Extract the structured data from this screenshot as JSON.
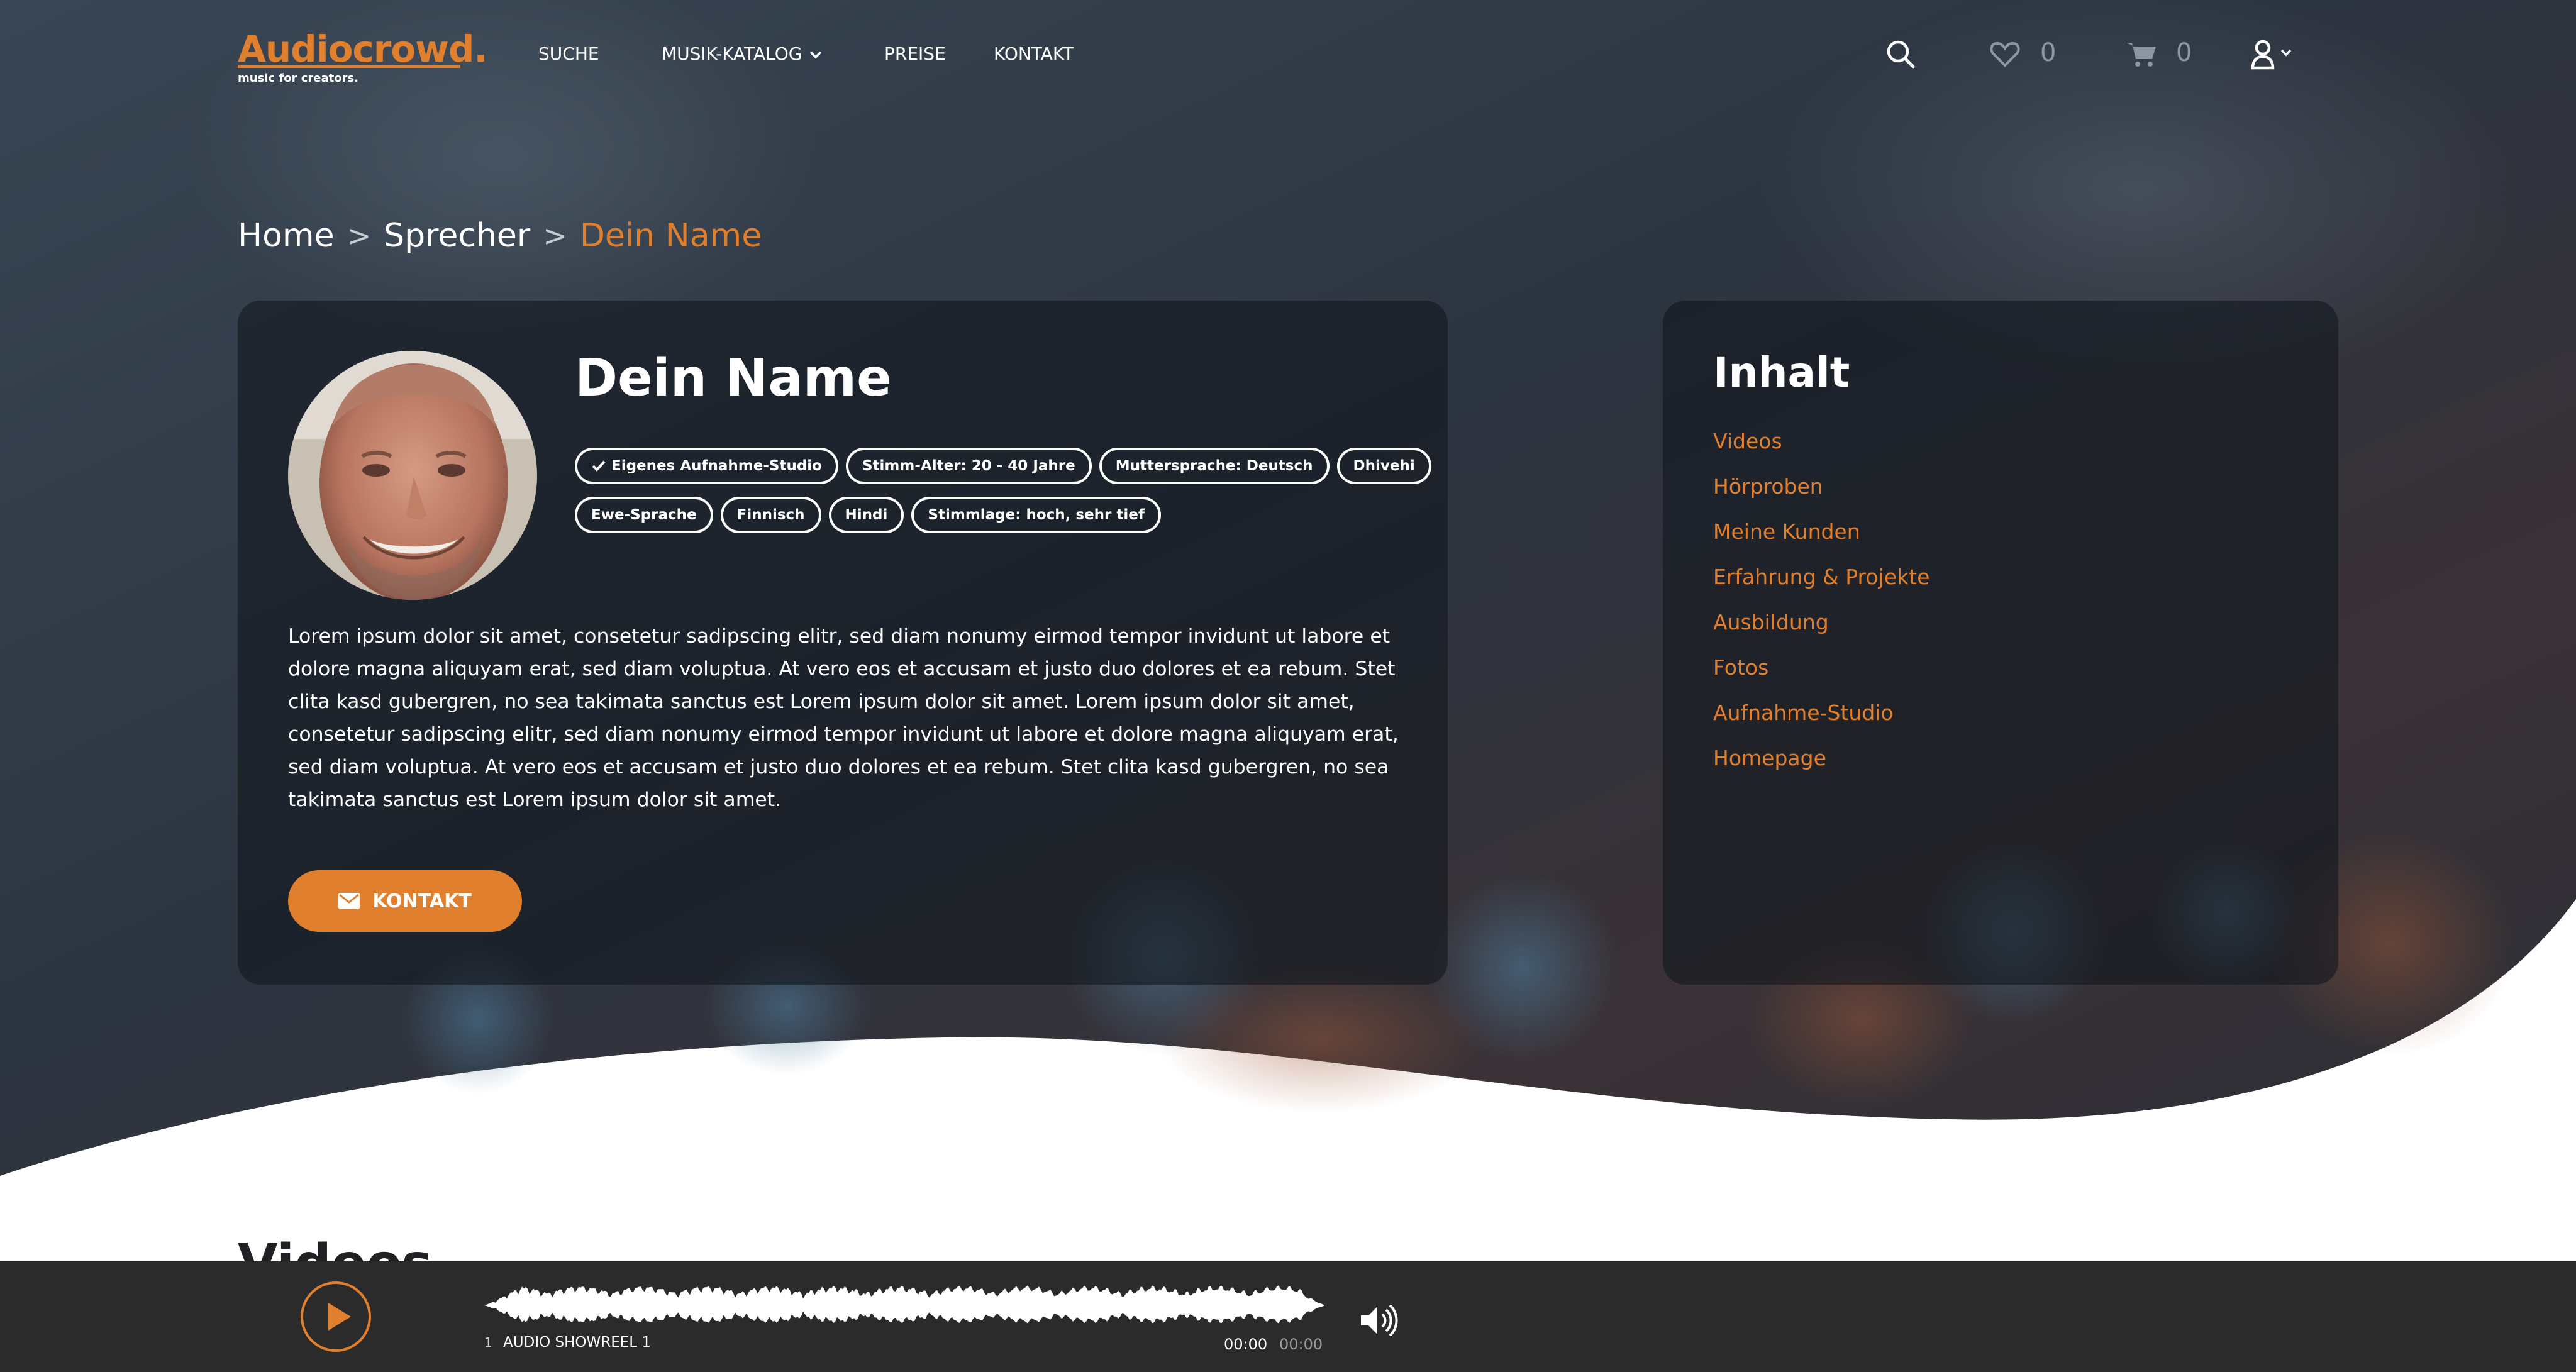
{
  "brand": {
    "name": "Audiocrowd.",
    "tagline": "music for creators."
  },
  "nav": {
    "links": [
      "SUCHE",
      "MUSIK-KATALOG",
      "PREISE",
      "KONTAKT"
    ],
    "wishlist_count": "0",
    "cart_count": "0"
  },
  "breadcrumb": {
    "items": [
      "Home",
      "Sprecher",
      "Dein Name"
    ],
    "separator": ">"
  },
  "profile": {
    "name": "Dein Name",
    "tags_row1": [
      "Eigenes Aufnahme-Studio",
      "Stimm-Alter: 20 - 40 Jahre",
      "Muttersprache: Deutsch",
      "Dhivehi"
    ],
    "tags_row2": [
      "Ewe-Sprache",
      "Finnisch",
      "Hindi",
      "Stimmlage: hoch, sehr tief"
    ],
    "bio": "Lorem ipsum dolor sit amet, consetetur sadipscing elitr, sed diam nonumy eirmod tempor invidunt ut labore et dolore magna aliquyam erat, sed diam voluptua. At vero eos et accusam et justo duo dolores et ea rebum. Stet clita kasd gubergren, no sea takimata sanctus est Lorem ipsum dolor sit amet. Lorem ipsum dolor sit amet, consetetur sadipscing elitr, sed diam nonumy eirmod tempor invidunt ut labore et dolore magna aliquyam erat, sed diam voluptua. At vero eos et accusam et justo duo dolores et ea rebum. Stet clita kasd gubergren, no sea takimata sanctus est Lorem ipsum dolor sit amet.",
    "contact_label": "KONTAKT"
  },
  "contents": {
    "title": "Inhalt",
    "items": [
      "Videos",
      "Hörproben",
      "Meine Kunden",
      "Erfahrung & Projekte",
      "Ausbildung",
      "Fotos",
      "Aufnahme-Studio",
      "Homepage"
    ]
  },
  "section": {
    "videos_heading": "Videos"
  },
  "player": {
    "track_number": "1",
    "track_title": "AUDIO SHOWREEL 1",
    "current_time": "00:00",
    "duration": "00:00"
  },
  "colors": {
    "accent": "#e07f2d",
    "player_bg": "#2b2b2b",
    "card_bg": "#14181f"
  },
  "icons": [
    "search-icon",
    "heart-icon",
    "cart-icon",
    "user-icon",
    "chevron-down-icon",
    "check-icon",
    "envelope-icon",
    "play-icon",
    "volume-icon"
  ]
}
